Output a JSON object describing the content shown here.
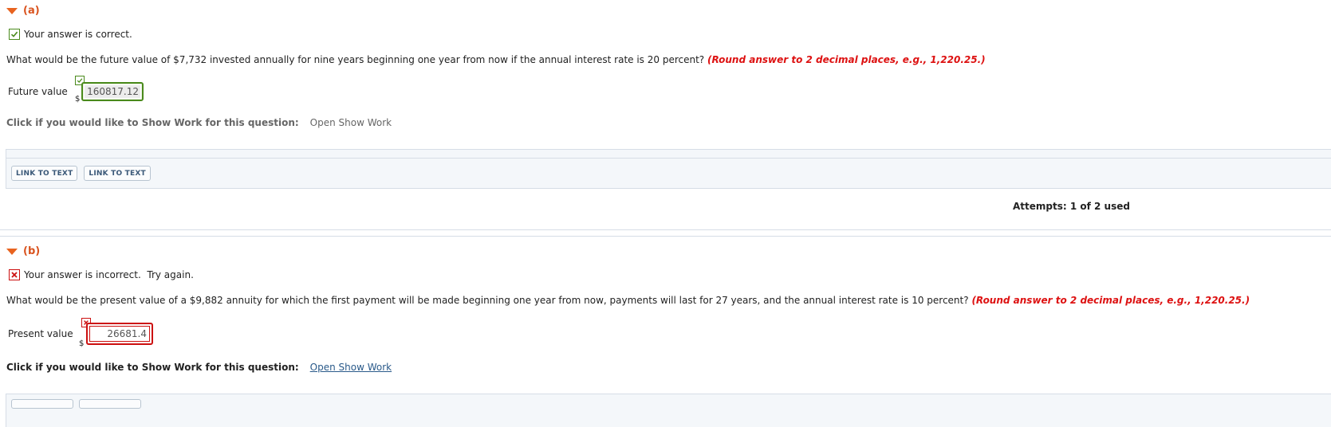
{
  "part_a": {
    "label": "(a)",
    "status_text": "Your answer is correct.",
    "question": "What would be the future value of $7,732 invested annually for nine years beginning one year from now if the annual interest rate is 20 percent?",
    "hint": "(Round answer to 2 decimal places, e.g., 1,220.25.)",
    "field_label": "Future value",
    "currency": "$",
    "value": "160817.12",
    "show_work_label": "Click if you would like to Show Work for this question:",
    "show_work_link": "Open Show Work",
    "buttons": [
      "LINK TO TEXT",
      "LINK TO TEXT"
    ],
    "attempts": "Attempts: 1 of 2 used"
  },
  "part_b": {
    "label": "(b)",
    "status_text": "Your answer is incorrect.  Try again.",
    "question": "What would be the present value of a $9,882 annuity for which the first payment will be made beginning one year from now, payments will last for 27 years, and the annual interest rate is 10 percent?",
    "hint": "(Round answer to 2 decimal places, e.g., 1,220.25.)",
    "field_label": "Present value",
    "currency": "$",
    "value": "26681.4",
    "show_work_label": "Click if you would like to Show Work for this question:",
    "show_work_link": "Open Show Work"
  },
  "icons": {
    "collapse": "chevron-down-icon",
    "correct": "checkmark-icon",
    "incorrect": "x-mark-icon"
  },
  "colors": {
    "accent_orange": "#e8631f",
    "correct_green": "#4a8a1c",
    "incorrect_red": "#cc1111",
    "hint_red": "#dd1111",
    "link_blue": "#2a5a8a"
  }
}
